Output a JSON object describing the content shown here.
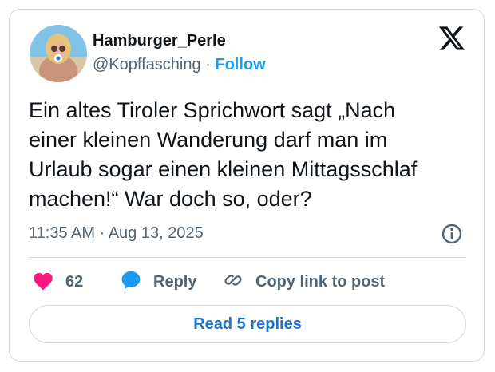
{
  "author": {
    "display_name": "Hamburger_Perle",
    "handle": "@Kopffasching",
    "separator": "·",
    "follow_label": "Follow"
  },
  "tweet": {
    "text": "Ein altes Tiroler Sprichwort sagt „Nach\neiner kleinen Wanderung darf man im\nUrlaub sogar einen kleinen Mittagsschlaf\nmachen!“ War doch so, oder?",
    "time": "11:35 AM",
    "date_separator": "·",
    "date": "Aug 13, 2025"
  },
  "actions": {
    "like_count": "62",
    "reply_label": "Reply",
    "copy_label": "Copy link to post"
  },
  "read_replies_label": "Read 5 replies",
  "colors": {
    "accent": "#1d9bf0",
    "like": "#f91880",
    "reply_icon": "#1d9bf0",
    "muted": "#536471",
    "border": "#cfd9de"
  },
  "icons": [
    "x-logo-icon",
    "info-icon",
    "heart-icon",
    "reply-bubble-icon",
    "link-icon"
  ]
}
